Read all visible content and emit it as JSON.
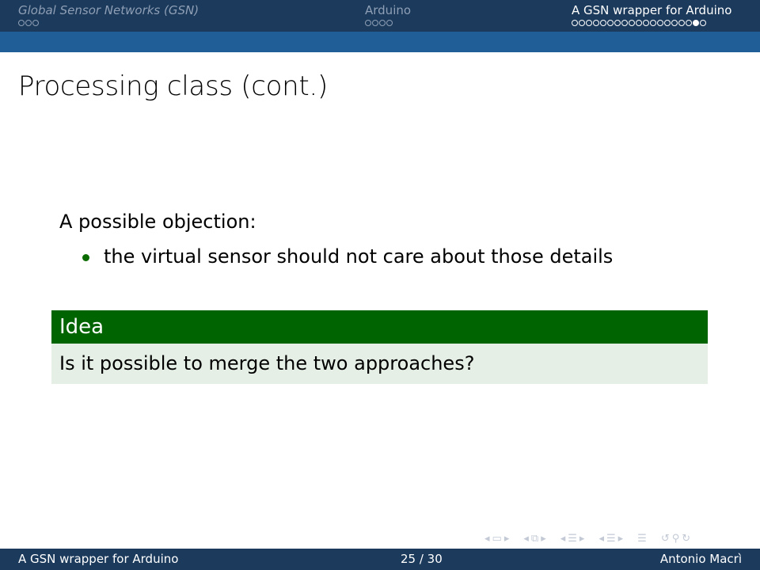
{
  "header": {
    "sections": [
      {
        "title": "Global Sensor Networks (GSN)",
        "dot_count": 3,
        "active_dot": -1
      },
      {
        "title": "Arduino",
        "dot_count": 4,
        "active_dot": -1
      },
      {
        "title": "A GSN wrapper for Arduino",
        "dot_count": 19,
        "active_dot": 17
      }
    ]
  },
  "frame": {
    "title": "Processing class (cont.)",
    "intro": "A possible objection:",
    "bullets": [
      "the virtual sensor should not care about those details"
    ],
    "block": {
      "title": "Idea",
      "body": "Is it possible to merge the two approaches?"
    }
  },
  "footer": {
    "left": "A GSN wrapper for Arduino",
    "page": "25 / 30",
    "author": "Antonio Macrì"
  },
  "colors": {
    "header_bg": "#1b3a5c",
    "header_strip": "#1f5e96",
    "block_title_bg": "#006400",
    "block_body_bg": "#e5efe5",
    "bullet": "#0b6b00"
  }
}
